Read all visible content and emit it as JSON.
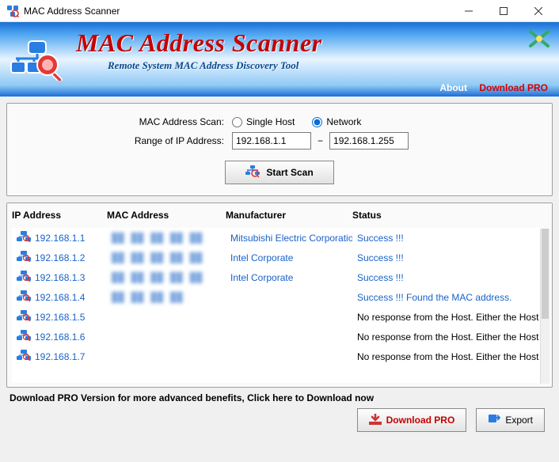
{
  "window": {
    "title": "MAC Address Scanner"
  },
  "banner": {
    "title": "MAC Address Scanner",
    "subtitle": "Remote System MAC Address Discovery Tool"
  },
  "topnav": {
    "about": "About",
    "download_pro": "Download PRO"
  },
  "config": {
    "scan_label": "MAC Address Scan:",
    "option_single": "Single Host",
    "option_network": "Network",
    "selected": "network",
    "range_label": "Range of IP Address:",
    "range_from": "192.168.1.1",
    "range_to": "192.168.1.255",
    "scan_button": "Start Scan"
  },
  "results": {
    "headers": {
      "ip": "IP Address",
      "mac": "MAC Address",
      "mfr": "Manufacturer",
      "status": "Status"
    },
    "rows": [
      {
        "ip": "192.168.1.1",
        "mac": "██ ██ ██ ██ ██",
        "mfr": "Mitsubishi Electric Corporation",
        "status": "Success !!!",
        "ok": true
      },
      {
        "ip": "192.168.1.2",
        "mac": "██ ██ ██ ██ ██",
        "mfr": "Intel Corporate",
        "status": "Success !!!",
        "ok": true
      },
      {
        "ip": "192.168.1.3",
        "mac": "██ ██ ██ ██ ██",
        "mfr": "Intel Corporate",
        "status": "Success !!!",
        "ok": true
      },
      {
        "ip": "192.168.1.4",
        "mac": "██ ██ ██ ██",
        "mfr": "",
        "status": "Success !!! Found the MAC address.",
        "ok": true
      },
      {
        "ip": "192.168.1.5",
        "mac": "",
        "mfr": "",
        "status": "No response from the Host. Either the Host is dow",
        "ok": false
      },
      {
        "ip": "192.168.1.6",
        "mac": "",
        "mfr": "",
        "status": "No response from the Host. Either the Host is dow",
        "ok": false
      },
      {
        "ip": "192.168.1.7",
        "mac": "",
        "mfr": "",
        "status": "No response from the Host. Either the Host is dow",
        "ok": false
      }
    ]
  },
  "footer": {
    "promo": "Download PRO Version for more advanced benefits, Click here to Download now",
    "download_pro": "Download PRO",
    "export": "Export"
  }
}
